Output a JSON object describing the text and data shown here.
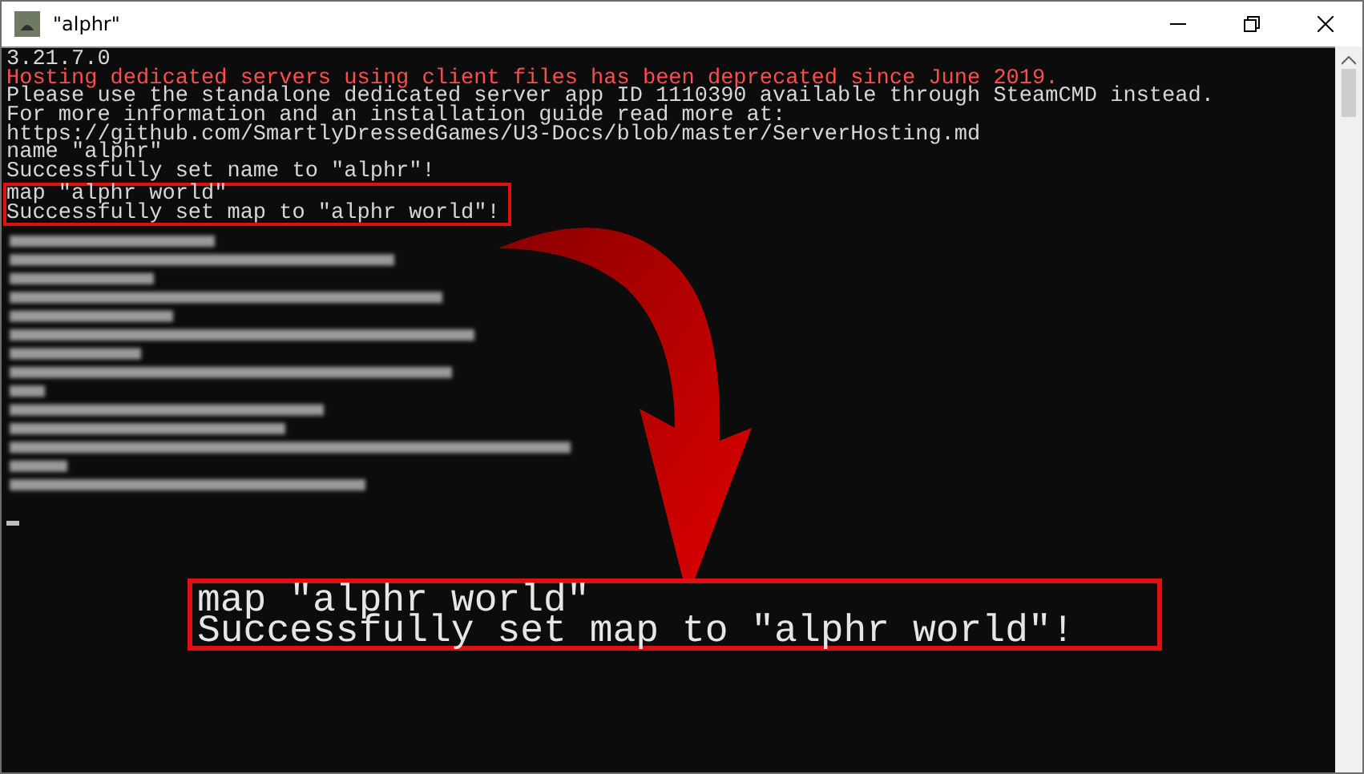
{
  "window": {
    "title": "\"alphr\""
  },
  "console": {
    "lines": [
      {
        "text": "3.21.7.0",
        "kind": "normal"
      },
      {
        "text": "Hosting dedicated servers using client files has been deprecated since June 2019.",
        "kind": "error"
      },
      {
        "text": "Please use the standalone dedicated server app ID 1110390 available through SteamCMD instead.",
        "kind": "normal"
      },
      {
        "text": "For more information and an installation guide read more at:",
        "kind": "normal"
      },
      {
        "text": "https://github.com/SmartlyDressedGames/U3-Docs/blob/master/ServerHosting.md",
        "kind": "normal"
      },
      {
        "text": "name \"alphr\"",
        "kind": "normal"
      },
      {
        "text": "Successfully set name to \"alphr\"!",
        "kind": "normal"
      }
    ],
    "highlighted": [
      {
        "text": "map \"alphr world\""
      },
      {
        "text": "Successfully set map to \"alphr world\"!"
      }
    ]
  },
  "zoom_inset": {
    "lines": [
      {
        "text": "map \"alphr world\""
      },
      {
        "text": "Successfully set map to \"alphr world\"!"
      }
    ]
  }
}
